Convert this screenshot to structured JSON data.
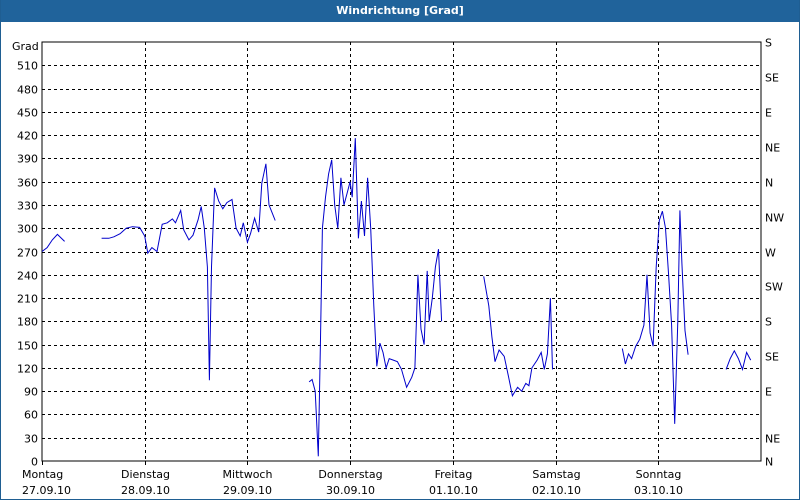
{
  "window": {
    "title": "Windrichtung [Grad]"
  },
  "chart_data": {
    "type": "line",
    "title": "Windrichtung [Grad]",
    "ylabel": "Grad",
    "ylim": [
      0,
      540
    ],
    "xlim": [
      0,
      7
    ],
    "grid": true,
    "y_ticks": [
      0,
      30,
      60,
      90,
      120,
      150,
      180,
      210,
      240,
      270,
      300,
      330,
      360,
      390,
      420,
      450,
      480,
      510
    ],
    "right_ticks": [
      {
        "value": 0,
        "label": "N"
      },
      {
        "value": 30,
        "label": "NE"
      },
      {
        "value": 60,
        "label": ""
      },
      {
        "value": 90,
        "label": "E"
      },
      {
        "value": 120,
        "label": ""
      },
      {
        "value": 135,
        "label": "SE"
      },
      {
        "value": 180,
        "label": "S"
      },
      {
        "value": 225,
        "label": "SW"
      },
      {
        "value": 270,
        "label": "W"
      },
      {
        "value": 315,
        "label": "NW"
      },
      {
        "value": 360,
        "label": "N"
      },
      {
        "value": 405,
        "label": "NE"
      },
      {
        "value": 450,
        "label": "E"
      },
      {
        "value": 495,
        "label": "SE"
      },
      {
        "value": 540,
        "label": "S"
      }
    ],
    "x_ticks": [
      {
        "value": 0,
        "day": "Montag",
        "date": "27.09.10"
      },
      {
        "value": 1,
        "day": "Dienstag",
        "date": "28.09.10"
      },
      {
        "value": 2,
        "day": "Mittwoch",
        "date": "29.09.10"
      },
      {
        "value": 3,
        "day": "Donnerstag",
        "date": "30.09.10"
      },
      {
        "value": 4,
        "day": "Freitag",
        "date": "01.10.10"
      },
      {
        "value": 5,
        "day": "Samstag",
        "date": "02.10.10"
      },
      {
        "value": 6,
        "day": "Sonntag",
        "date": "03.10.10"
      }
    ],
    "series_color": "#0000cc",
    "segments": [
      [
        [
          0.0,
          270
        ],
        [
          0.05,
          275
        ],
        [
          0.1,
          285
        ],
        [
          0.15,
          292
        ],
        [
          0.22,
          283
        ]
      ],
      [
        [
          0.58,
          287
        ],
        [
          0.65,
          287
        ],
        [
          0.7,
          289
        ],
        [
          0.76,
          293
        ],
        [
          0.82,
          300
        ],
        [
          0.88,
          302
        ],
        [
          0.95,
          301
        ],
        [
          1.0,
          290
        ],
        [
          1.03,
          268
        ],
        [
          1.07,
          275
        ],
        [
          1.12,
          270
        ],
        [
          1.17,
          305
        ],
        [
          1.22,
          307
        ],
        [
          1.27,
          312
        ],
        [
          1.3,
          307
        ],
        [
          1.35,
          323
        ],
        [
          1.38,
          298
        ],
        [
          1.43,
          285
        ],
        [
          1.47,
          291
        ],
        [
          1.52,
          311
        ],
        [
          1.55,
          328
        ],
        [
          1.58,
          300
        ],
        [
          1.61,
          250
        ],
        [
          1.63,
          104
        ],
        [
          1.65,
          250
        ],
        [
          1.68,
          352
        ],
        [
          1.72,
          335
        ],
        [
          1.76,
          325
        ],
        [
          1.8,
          333
        ],
        [
          1.85,
          337
        ],
        [
          1.89,
          300
        ],
        [
          1.93,
          290
        ],
        [
          1.96,
          307
        ],
        [
          2.0,
          282
        ],
        [
          2.03,
          293
        ],
        [
          2.07,
          313
        ],
        [
          2.11,
          295
        ],
        [
          2.14,
          358
        ],
        [
          2.18,
          383
        ],
        [
          2.21,
          330
        ],
        [
          2.24,
          320
        ],
        [
          2.27,
          310
        ]
      ],
      [
        [
          2.6,
          102
        ],
        [
          2.63,
          105
        ],
        [
          2.66,
          90
        ],
        [
          2.69,
          6
        ],
        [
          2.71,
          150
        ],
        [
          2.73,
          300
        ],
        [
          2.76,
          340
        ],
        [
          2.79,
          370
        ],
        [
          2.82,
          388
        ],
        [
          2.85,
          330
        ],
        [
          2.88,
          300
        ],
        [
          2.91,
          365
        ],
        [
          2.94,
          330
        ],
        [
          2.97,
          345
        ],
        [
          3.0,
          360
        ],
        [
          3.02,
          340
        ],
        [
          3.05,
          416
        ],
        [
          3.08,
          287
        ],
        [
          3.11,
          335
        ],
        [
          3.14,
          290
        ],
        [
          3.17,
          365
        ],
        [
          3.2,
          300
        ],
        [
          3.23,
          200
        ],
        [
          3.26,
          122
        ],
        [
          3.29,
          152
        ],
        [
          3.32,
          140
        ],
        [
          3.35,
          120
        ],
        [
          3.38,
          132
        ],
        [
          3.42,
          130
        ],
        [
          3.46,
          128
        ],
        [
          3.5,
          118
        ],
        [
          3.55,
          95
        ],
        [
          3.6,
          108
        ],
        [
          3.63,
          120
        ],
        [
          3.66,
          240
        ],
        [
          3.69,
          170
        ],
        [
          3.72,
          150
        ],
        [
          3.75,
          245
        ],
        [
          3.77,
          180
        ],
        [
          3.8,
          210
        ],
        [
          3.83,
          250
        ],
        [
          3.86,
          273
        ],
        [
          3.89,
          180
        ]
      ],
      [
        [
          4.3,
          238
        ],
        [
          4.35,
          200
        ],
        [
          4.38,
          160
        ],
        [
          4.41,
          128
        ],
        [
          4.45,
          143
        ],
        [
          4.5,
          135
        ],
        [
          4.54,
          110
        ],
        [
          4.58,
          84
        ],
        [
          4.63,
          95
        ],
        [
          4.67,
          90
        ],
        [
          4.71,
          100
        ],
        [
          4.74,
          97
        ],
        [
          4.77,
          120
        ],
        [
          4.82,
          130
        ],
        [
          4.86,
          140
        ],
        [
          4.89,
          118
        ],
        [
          4.92,
          138
        ],
        [
          4.95,
          210
        ],
        [
          4.97,
          118
        ]
      ],
      [
        [
          5.65,
          145
        ],
        [
          5.68,
          125
        ],
        [
          5.71,
          138
        ],
        [
          5.74,
          132
        ],
        [
          5.78,
          148
        ],
        [
          5.82,
          157
        ],
        [
          5.86,
          175
        ],
        [
          5.89,
          240
        ],
        [
          5.92,
          165
        ],
        [
          5.95,
          148
        ],
        [
          5.98,
          250
        ],
        [
          6.01,
          310
        ],
        [
          6.04,
          322
        ],
        [
          6.07,
          300
        ],
        [
          6.1,
          240
        ],
        [
          6.13,
          175
        ],
        [
          6.16,
          48
        ],
        [
          6.19,
          180
        ],
        [
          6.21,
          323
        ],
        [
          6.23,
          255
        ],
        [
          6.26,
          168
        ],
        [
          6.29,
          137
        ]
      ],
      [
        [
          6.66,
          118
        ],
        [
          6.7,
          132
        ],
        [
          6.74,
          142
        ],
        [
          6.78,
          132
        ],
        [
          6.82,
          118
        ],
        [
          6.86,
          140
        ],
        [
          6.9,
          130
        ]
      ]
    ]
  }
}
